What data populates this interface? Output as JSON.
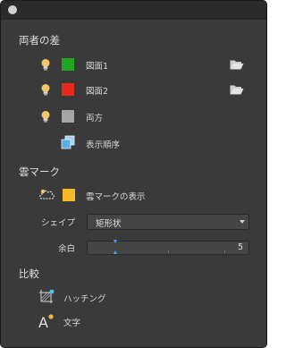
{
  "sections": {
    "diff_title": "両者の差",
    "cloud_title": "雲マーク",
    "compare_title": "比較"
  },
  "layers": [
    {
      "label": "図面1",
      "color": "#1fa51f",
      "icon": "lightbulb-icon",
      "action_icon": "folder-open-icon"
    },
    {
      "label": "図面2",
      "color": "#e8291d",
      "icon": "lightbulb-icon",
      "action_icon": "folder-open-icon"
    },
    {
      "label": "両方",
      "color": "#a5a5a5",
      "icon": "lightbulb-icon"
    }
  ],
  "display_order_label": "表示順序",
  "cloud": {
    "show_label": "雲マークの表示",
    "swatch_color": "#f5b928",
    "shape_label": "シェイプ",
    "shape_value": "矩形状",
    "margin_label": "余白",
    "margin_value": "5"
  },
  "compare": {
    "hatching_label": "ハッチング",
    "text_label": "文字"
  }
}
